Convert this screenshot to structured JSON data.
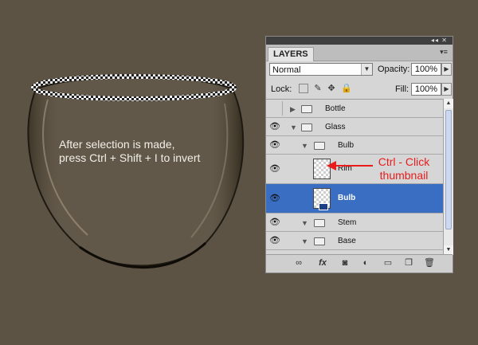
{
  "canvas": {
    "caption_lines": [
      "After selection is made,",
      "press Ctrl + Shift + I to invert"
    ],
    "background": "#5d5344"
  },
  "panel": {
    "tab_label": "LAYERS",
    "blend_mode": "Normal",
    "opacity_label": "Opacity:",
    "opacity_value": "100%",
    "lock_label": "Lock:",
    "fill_label": "Fill:",
    "fill_value": "100%",
    "layers": [
      {
        "name": "Bottle",
        "type": "group",
        "visible": false,
        "expanded": false,
        "indent": 0
      },
      {
        "name": "Glass",
        "type": "group",
        "visible": true,
        "expanded": true,
        "indent": 0
      },
      {
        "name": "Bulb",
        "type": "group",
        "visible": true,
        "expanded": true,
        "indent": 1
      },
      {
        "name": "Rim",
        "type": "layer",
        "visible": true,
        "indent": 2
      },
      {
        "name": "Bulb",
        "type": "layer",
        "visible": true,
        "indent": 2,
        "selected": true
      },
      {
        "name": "Stem",
        "type": "group",
        "visible": true,
        "expanded": true,
        "indent": 1
      },
      {
        "name": "Base",
        "type": "group",
        "visible": true,
        "expanded": true,
        "indent": 1
      }
    ],
    "selection_color": "#3a6ec2",
    "bottom_icons": [
      "link-icon",
      "fx-icon",
      "mask-icon",
      "adjustment-icon",
      "group-icon",
      "new-layer-icon",
      "trash-icon"
    ],
    "fx_label": "fx"
  },
  "annotation": {
    "lines": [
      "Ctrl - Click",
      "thumbnail"
    ],
    "color": "#e81c1c"
  }
}
